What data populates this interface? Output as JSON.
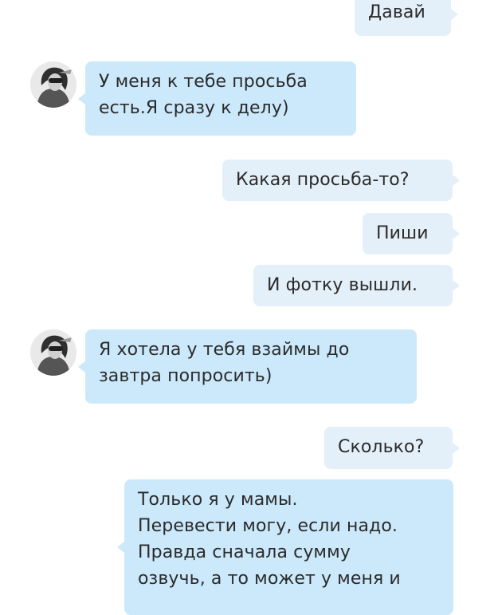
{
  "chat": {
    "messages": [
      {
        "from": "me",
        "text": "Давай"
      },
      {
        "from": "them",
        "lines": [
          "У меня к тебе просьба",
          "есть.Я сразу к делу)"
        ]
      },
      {
        "from": "me",
        "text": "Какая просьба-то?"
      },
      {
        "from": "me",
        "text": "Пиши"
      },
      {
        "from": "me",
        "text": "И фотку вышли."
      },
      {
        "from": "them",
        "lines": [
          "Я хотела у тебя взаймы до",
          "завтра попросить)"
        ]
      },
      {
        "from": "me",
        "text": "Сколько?"
      },
      {
        "from": "them",
        "lines": [
          "Только я у мамы.",
          "Перевести могу, если надо.",
          "Правда сначала сумму",
          "озвучь, а то может у меня и"
        ]
      }
    ]
  },
  "avatar_icon": "contact-avatar-photo-icon",
  "colors": {
    "incoming_bubble": "#cbe9fb",
    "outgoing_bubble": "#e4f0f9",
    "text": "#2b2b2b"
  }
}
